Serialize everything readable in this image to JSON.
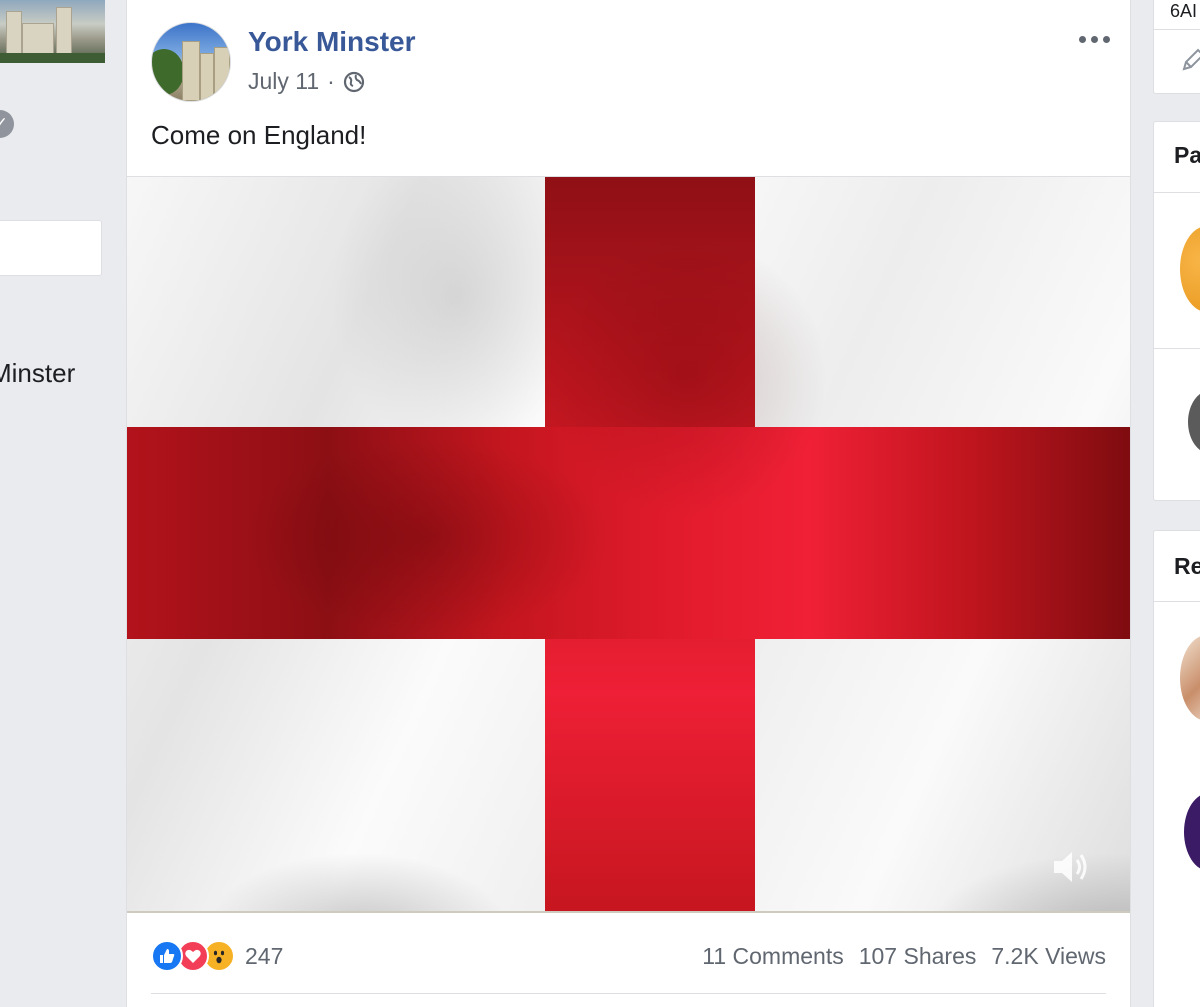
{
  "left_column": {
    "page_name_partial": "Minster"
  },
  "post": {
    "page_name": "York Minster",
    "date": "July 11",
    "separator": "·",
    "audience_icon": "globe-icon",
    "text": "Come on England!",
    "more_icon": "more-options-icon",
    "video": {
      "content": "St George's Cross flag waving",
      "volume_icon": "volume-icon"
    },
    "engagement": {
      "reactions": [
        "like",
        "love",
        "wow"
      ],
      "reaction_count": "247",
      "comments": "11 Comments",
      "shares": "107 Shares",
      "views": "7.2K Views"
    }
  },
  "right_column": {
    "top_card_text": "6AI",
    "card1_heading": "Pa",
    "card2_heading": "Re",
    "edit_icon": "pencil-icon"
  },
  "colors": {
    "page_background": "#e9ebee",
    "link_blue": "#385898",
    "secondary_text": "#606770",
    "flag_red": "#e21b2c",
    "like_blue": "#1877f2",
    "love_red": "#f33e58",
    "wow_yellow": "#f7b125"
  }
}
